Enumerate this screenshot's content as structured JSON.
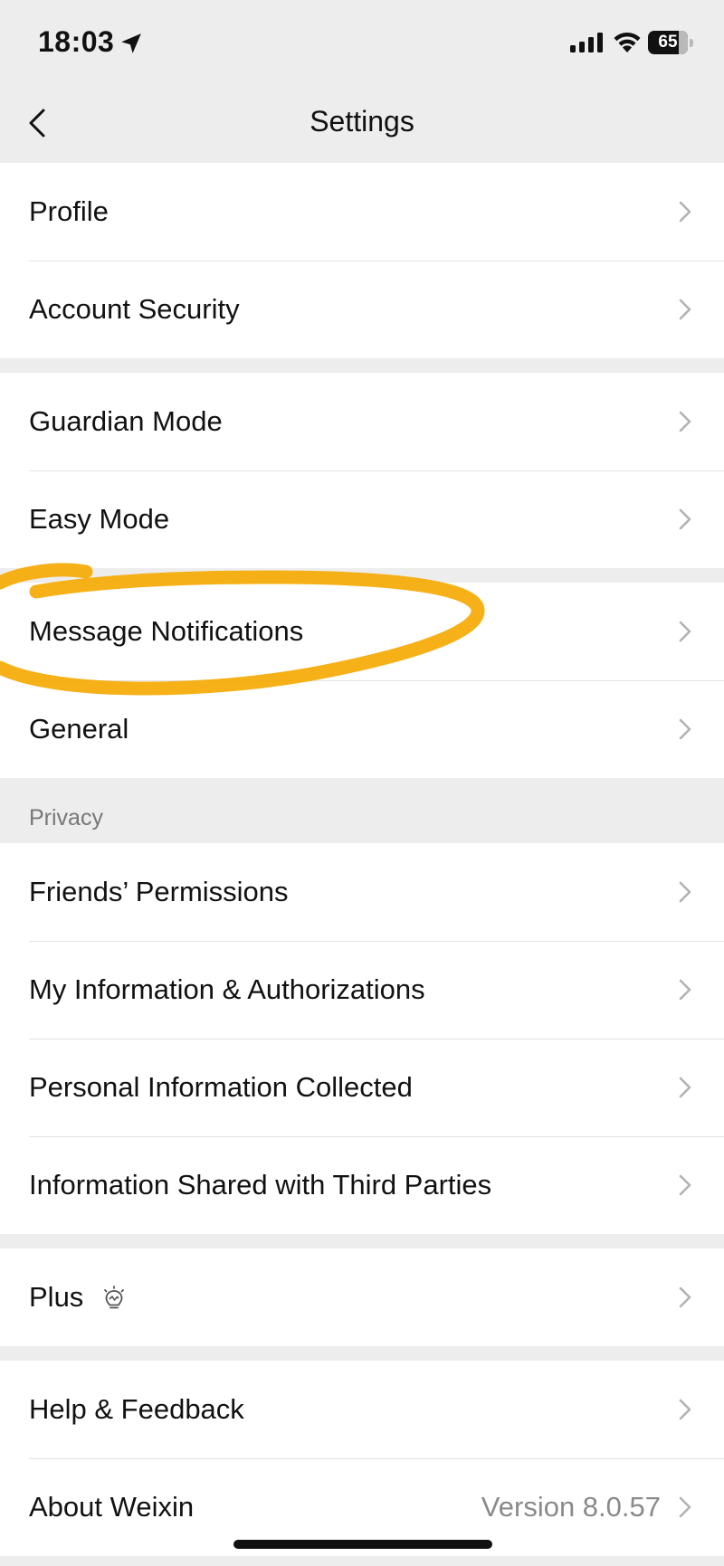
{
  "status_bar": {
    "time": "18:03",
    "battery": "65",
    "icons": [
      "location-arrow-icon",
      "cellular-signal-icon",
      "wifi-icon",
      "battery-icon"
    ]
  },
  "nav": {
    "title": "Settings",
    "back_icon": "chevron-left-icon"
  },
  "sections": {
    "account": [
      {
        "label": "Profile"
      },
      {
        "label": "Account Security"
      }
    ],
    "modes": [
      {
        "label": "Guardian Mode"
      },
      {
        "label": "Easy Mode"
      }
    ],
    "app": [
      {
        "label": "Message Notifications",
        "highlighted": true
      },
      {
        "label": "General"
      }
    ],
    "privacy_header": "Privacy",
    "privacy": [
      {
        "label": "Friends’ Permissions"
      },
      {
        "label": "My Information & Authorizations"
      },
      {
        "label": "Personal Information Collected"
      },
      {
        "label": "Information Shared with Third Parties"
      }
    ],
    "plus": [
      {
        "label": "Plus",
        "icon": "lightbulb-icon"
      }
    ],
    "about": [
      {
        "label": "Help & Feedback"
      },
      {
        "label": "About Weixin",
        "value": "Version 8.0.57"
      }
    ]
  },
  "colors": {
    "background": "#ededed",
    "card": "#ffffff",
    "highlight_stroke": "#f5a800"
  }
}
